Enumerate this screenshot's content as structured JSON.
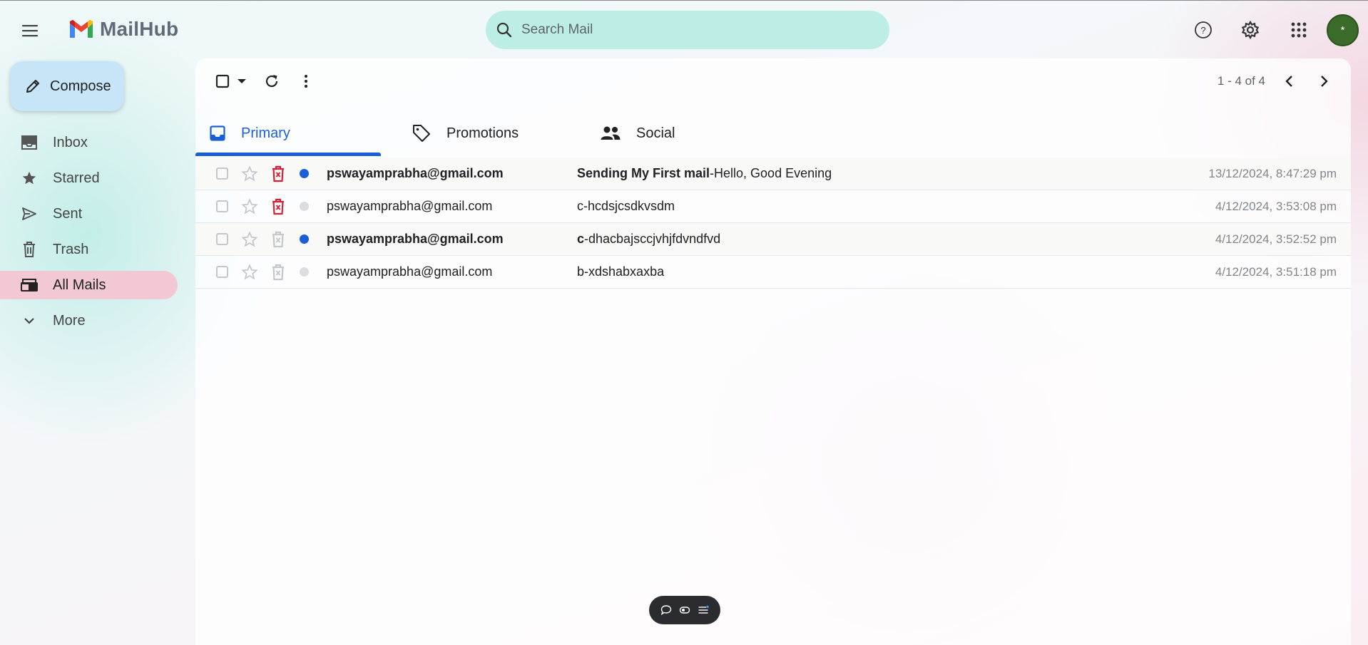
{
  "app": {
    "name": "MailHub"
  },
  "search": {
    "placeholder": "Search Mail"
  },
  "avatar": {
    "initial": "*"
  },
  "sidebar": {
    "compose_label": "Compose",
    "items": [
      {
        "label": "Inbox",
        "icon": "inbox-icon"
      },
      {
        "label": "Starred",
        "icon": "star-icon"
      },
      {
        "label": "Sent",
        "icon": "send-icon"
      },
      {
        "label": "Trash",
        "icon": "trash-icon"
      },
      {
        "label": "All Mails",
        "icon": "all-mail-icon",
        "active": true
      },
      {
        "label": "More",
        "icon": "chevron-down-icon"
      }
    ]
  },
  "toolbar": {
    "pager": "1 - 4 of 4"
  },
  "tabs": [
    {
      "label": "Primary",
      "active": true
    },
    {
      "label": "Promotions"
    },
    {
      "label": "Social"
    }
  ],
  "emails": [
    {
      "sender": "pswayamprabha@gmail.com",
      "subject": "Sending My First mail",
      "snippet": "-Hello, Good Evening",
      "time": "13/12/2024, 8:47:29 pm",
      "unread": true,
      "trash_active": true
    },
    {
      "sender": "pswayamprabha@gmail.com",
      "subject": "c",
      "snippet": "-hcdsjcsdkvsdm",
      "time": "4/12/2024, 3:53:08 pm",
      "unread": false,
      "trash_active": true
    },
    {
      "sender": "pswayamprabha@gmail.com",
      "subject": "c",
      "snippet": "-dhacbajsccjvhjfdvndfvd",
      "time": "4/12/2024, 3:52:52 pm",
      "unread": true,
      "trash_active": false
    },
    {
      "sender": "pswayamprabha@gmail.com",
      "subject": "b",
      "snippet": "-xdshabxaxba",
      "time": "4/12/2024, 3:51:18 pm",
      "unread": false,
      "trash_active": false
    }
  ],
  "colors": {
    "accent": "#1a5fd6",
    "unread_dot": "#1a5fd6",
    "read_dot": "#dadce0",
    "trash_active": "#d6213a",
    "trash_inactive": "#c4c7cc",
    "active_nav": "#f2c9d3",
    "search_bg": "#bdeee6",
    "compose_bg": "#c6e6f7"
  }
}
